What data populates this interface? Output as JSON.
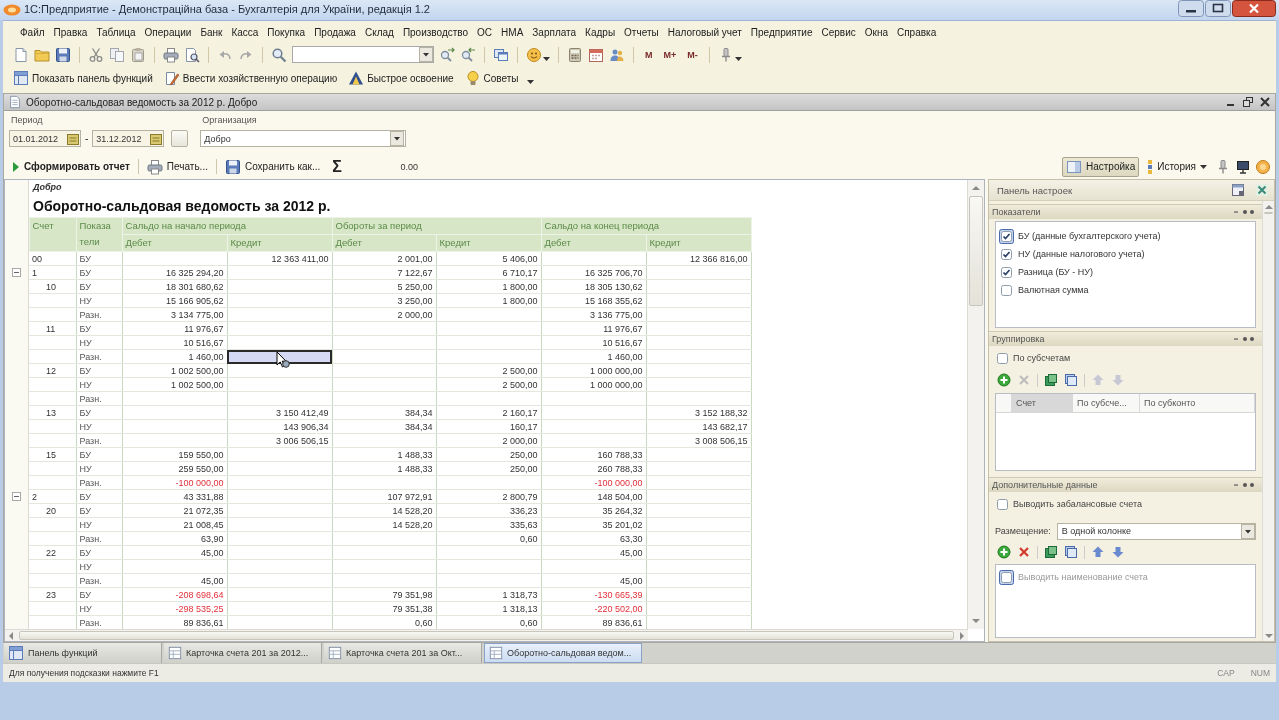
{
  "window": {
    "title": "1С:Предприятие - Демонстраційна база - Бухгалтерія для України, редакція 1.2"
  },
  "menu": [
    "Файл",
    "Правка",
    "Таблица",
    "Операции",
    "Банк",
    "Касса",
    "Покупка",
    "Продажа",
    "Склад",
    "Производство",
    "ОС",
    "НМА",
    "Зарплата",
    "Кадры",
    "Отчеты",
    "Налоговый учет",
    "Предприятие",
    "Сервис",
    "Окна",
    "Справка"
  ],
  "toolbar": {
    "memory_buttons": [
      "M",
      "M+",
      "M-"
    ]
  },
  "quick_toolbar": [
    {
      "label": "Показать панель функций"
    },
    {
      "label": "Ввести хозяйственную операцию"
    },
    {
      "label": "Быстрое освоение"
    },
    {
      "label": "Советы"
    }
  ],
  "document": {
    "title": "Оборотно-сальдовая ведомость за 2012 р. Добро",
    "period": {
      "label": "Период",
      "from": "01.01.2012",
      "separator": "-",
      "to": "31.12.2012"
    },
    "organization": {
      "label": "Организация",
      "value": "Добро"
    },
    "report_toolbar": {
      "generate": "Сформировать отчет",
      "print": "Печать...",
      "save": "Сохранить как...",
      "sum_symbol": "Σ",
      "sum": "0.00",
      "settings": {
        "label": "Настройка",
        "selected": true
      },
      "history": "История"
    },
    "report": {
      "organization": "Добро",
      "title": "Оборотно-сальдовая ведомость за 2012 р.",
      "table": {
        "header": {
          "account": "Счет",
          "indicator": [
            "Показа",
            "тели"
          ],
          "groups": [
            {
              "label": "Сальдо на начало периода",
              "debit": "Дебет",
              "credit": "Кредит",
              "debit_selected": false,
              "credit_selected": true
            },
            {
              "label": "Обороты за период",
              "debit": "Дебет",
              "credit": "Кредит",
              "debit_selected": false,
              "credit_selected": false
            },
            {
              "label": "Сальдо на конец периода",
              "debit": "Дебет",
              "credit": "Кредит",
              "debit_selected": false,
              "credit_selected": false
            }
          ]
        },
        "rows": [
          {
            "account": "00",
            "lines": [
              {
                "indicator": "БУ",
                "opening_credit": "12 363 411,00",
                "turnover_debit": "2 001,00",
                "turnover_credit": "5 406,00",
                "closing_credit": "12 366 816,00",
                "negative_balance": false,
                "selected": false
              }
            ]
          },
          {
            "account": "1",
            "expanded": true,
            "lines": [
              {
                "indicator": "БУ",
                "opening_debit": "16 325 294,20",
                "turnover_debit": "7 122,67",
                "turnover_credit": "6 710,17",
                "closing_debit": "16 325 706,70",
                "negative_balance": false,
                "selected": false
              }
            ],
            "children": [
              {
                "account": "10",
                "lines": [
                  {
                    "indicator": "БУ",
                    "opening_debit": "18 301 680,62",
                    "turnover_debit": "5 250,00",
                    "turnover_credit": "1 800,00",
                    "closing_debit": "18 305 130,62",
                    "negative_balance": false,
                    "selected": false
                  },
                  {
                    "indicator": "НУ",
                    "opening_debit": "15 166 905,62",
                    "turnover_debit": "3 250,00",
                    "turnover_credit": "1 800,00",
                    "closing_debit": "15 168 355,62",
                    "negative_balance": false,
                    "selected": false
                  },
                  {
                    "indicator": "Разн.",
                    "opening_debit": "3 134 775,00",
                    "turnover_debit": "2 000,00",
                    "closing_debit": "3 136 775,00",
                    "negative_balance": false,
                    "selected": false
                  }
                ]
              },
              {
                "account": "11",
                "lines": [
                  {
                    "indicator": "БУ",
                    "opening_debit": "11 976,67",
                    "closing_debit": "11 976,67",
                    "negative_balance": false,
                    "selected": false
                  },
                  {
                    "indicator": "НУ",
                    "opening_debit": "10 516,67",
                    "closing_debit": "10 516,67",
                    "negative_balance": false,
                    "selected": false
                  },
                  {
                    "indicator": "Разн.",
                    "opening_debit": "1 460,00",
                    "closing_debit": "1 460,00",
                    "negative_balance": false,
                    "selected": true
                  }
                ]
              },
              {
                "account": "12",
                "lines": [
                  {
                    "indicator": "БУ",
                    "opening_debit": "1 002 500,00",
                    "turnover_credit": "2 500,00",
                    "closing_debit": "1 000 000,00",
                    "negative_balance": false,
                    "selected": false
                  },
                  {
                    "indicator": "НУ",
                    "opening_debit": "1 002 500,00",
                    "turnover_credit": "2 500,00",
                    "closing_debit": "1 000 000,00",
                    "negative_balance": false,
                    "selected": false
                  },
                  {
                    "indicator": "Разн.",
                    "selected": false
                  }
                ]
              },
              {
                "account": "13",
                "lines": [
                  {
                    "indicator": "БУ",
                    "opening_credit": "3 150 412,49",
                    "turnover_debit": "384,34",
                    "turnover_credit": "2 160,17",
                    "closing_credit": "3 152 188,32",
                    "negative_balance": false,
                    "selected": false
                  },
                  {
                    "indicator": "НУ",
                    "opening_credit": "143 906,34",
                    "turnover_debit": "384,34",
                    "turnover_credit": "160,17",
                    "closing_credit": "143 682,17",
                    "negative_balance": false,
                    "selected": false
                  },
                  {
                    "indicator": "Разн.",
                    "opening_credit": "3 006 506,15",
                    "turnover_credit": "2 000,00",
                    "closing_credit": "3 008 506,15",
                    "negative_balance": false,
                    "selected": false
                  }
                ]
              },
              {
                "account": "15",
                "lines": [
                  {
                    "indicator": "БУ",
                    "opening_debit": "159 550,00",
                    "turnover_debit": "1 488,33",
                    "turnover_credit": "250,00",
                    "closing_debit": "160 788,33",
                    "negative_balance": false,
                    "selected": false
                  },
                  {
                    "indicator": "НУ",
                    "opening_debit": "259 550,00",
                    "turnover_debit": "1 488,33",
                    "turnover_credit": "250,00",
                    "closing_debit": "260 788,33",
                    "negative_balance": false,
                    "selected": false
                  },
                  {
                    "indicator": "Разн.",
                    "opening_debit": "-100 000,00",
                    "closing_debit": "-100 000,00",
                    "negative_balance": true,
                    "selected": false
                  }
                ]
              }
            ]
          },
          {
            "account": "2",
            "expanded": true,
            "lines": [
              {
                "indicator": "БУ",
                "opening_debit": "43 331,88",
                "turnover_debit": "107 972,91",
                "turnover_credit": "2 800,79",
                "closing_debit": "148 504,00",
                "negative_balance": false,
                "selected": false
              }
            ],
            "children": [
              {
                "account": "20",
                "lines": [
                  {
                    "indicator": "БУ",
                    "opening_debit": "21 072,35",
                    "turnover_debit": "14 528,20",
                    "turnover_credit": "336,23",
                    "closing_debit": "35 264,32",
                    "negative_balance": false,
                    "selected": false
                  },
                  {
                    "indicator": "НУ",
                    "opening_debit": "21 008,45",
                    "turnover_debit": "14 528,20",
                    "turnover_credit": "335,63",
                    "closing_debit": "35 201,02",
                    "negative_balance": false,
                    "selected": false
                  },
                  {
                    "indicator": "Разн.",
                    "opening_debit": "63,90",
                    "turnover_credit": "0,60",
                    "closing_debit": "63,30",
                    "negative_balance": false,
                    "selected": false
                  }
                ]
              },
              {
                "account": "22",
                "lines": [
                  {
                    "indicator": "БУ",
                    "opening_debit": "45,00",
                    "closing_debit": "45,00",
                    "negative_balance": false,
                    "selected": false
                  },
                  {
                    "indicator": "НУ",
                    "selected": false
                  },
                  {
                    "indicator": "Разн.",
                    "opening_debit": "45,00",
                    "closing_debit": "45,00",
                    "negative_balance": false,
                    "selected": false
                  }
                ]
              },
              {
                "account": "23",
                "lines": [
                  {
                    "indicator": "БУ",
                    "opening_debit": "-208 698,64",
                    "turnover_debit": "79 351,98",
                    "turnover_credit": "1 318,73",
                    "closing_debit": "-130 665,39",
                    "negative_balance": true,
                    "selected": false
                  },
                  {
                    "indicator": "НУ",
                    "opening_debit": "-298 535,25",
                    "turnover_debit": "79 351,38",
                    "turnover_credit": "1 318,13",
                    "closing_debit": "-220 502,00",
                    "negative_balance": true,
                    "selected": false
                  },
                  {
                    "indicator": "Разн.",
                    "opening_debit": "89 836,61",
                    "turnover_debit": "0,60",
                    "turnover_credit": "0,60",
                    "closing_debit": "89 836,61",
                    "negative_balance": false,
                    "selected": false
                  }
                ]
              }
            ]
          }
        ]
      }
    },
    "settings_panel": {
      "title": "Панель настроек",
      "sections": [
        {
          "title": "Показатели",
          "kind": "checklist",
          "items": [
            {
              "label": "БУ (данные бухгалтерского учета)",
              "checked": true,
              "focused": true
            },
            {
              "label": "НУ (данные налогового учета)",
              "checked": true,
              "focused": false
            },
            {
              "label": "Разница (БУ - НУ)",
              "checked": true,
              "focused": false
            },
            {
              "label": "Валютная сумма",
              "checked": false,
              "focused": false
            }
          ]
        },
        {
          "title": "Группировка",
          "kind": "grouping",
          "option": {
            "label": "По субсчетам",
            "checked": false
          },
          "row_actions_enabled": false,
          "columns": [
            "Счет",
            "По субсче...",
            "По субконто"
          ]
        },
        {
          "title": "Дополнительные данные",
          "kind": "extra",
          "option": {
            "label": "Выводить забалансовые счета",
            "checked": false
          },
          "placement": {
            "label": "Размещение:",
            "value": "В одной колонке"
          },
          "row_actions_enabled": true,
          "items": [
            {
              "label": "Выводить наименование счета",
              "checked": false,
              "focused": true
            }
          ]
        }
      ]
    }
  },
  "window_tabs": [
    {
      "label": "Панель функций",
      "kind": "panel",
      "selected": false
    },
    {
      "label": "Карточка счета 201 за 2012...",
      "kind": "report",
      "selected": false
    },
    {
      "label": "Карточка счета 201 за Окт...",
      "kind": "report",
      "selected": false
    },
    {
      "label": "Оборотно-сальдовая ведом...",
      "kind": "report",
      "selected": true
    }
  ],
  "status_bar": {
    "hint": "Для получения подсказки нажмите F1",
    "indicators": [
      "CAP",
      "NUM"
    ]
  }
}
